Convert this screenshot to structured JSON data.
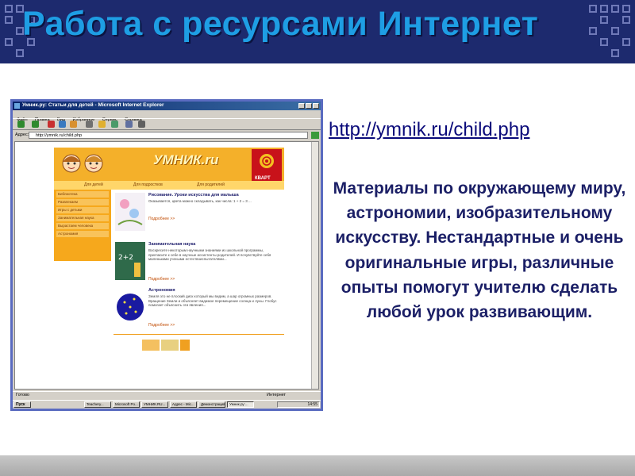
{
  "slide": {
    "title": "Работа с ресурсами Интернет",
    "url": "http://ymnik.ru/child.php",
    "description": "Материалы по окружающему миру, астрономии, изобразительному искусству. Нестандартные и очень оригинальные игры, различные опыты помогут учителю сделать любой урок развивающим.",
    "colors": {
      "header_bg": "#1d2a6e",
      "title": "#1e9ee4",
      "text": "#1b1f66"
    }
  },
  "browser": {
    "title": "Умник.ру: Статьи для детей - Microsoft Internet Explorer",
    "menu": [
      "Файл",
      "Правка",
      "Вид",
      "Избранное",
      "Сервис",
      "Справка"
    ],
    "toolbar_icons": [
      "back-icon",
      "forward-icon",
      "stop-icon",
      "refresh-icon",
      "home-icon",
      "search-icon",
      "favorites-icon",
      "history-icon",
      "mail-icon",
      "print-icon"
    ],
    "address_label": "Адрес:",
    "address": "http://ymnik.ru/child.php",
    "status_left": "Готово",
    "status_right": "Интернет"
  },
  "site": {
    "logo": "УМНИК.ru",
    "brand": "КВАРТ",
    "nav": [
      "Для детей",
      "Для подростков",
      "Для родителей"
    ],
    "sidebar": [
      "Библиотека",
      "Развлекаем",
      "Игры с детьми",
      "Занимательная наука",
      "Вырастаем человека",
      "Астрономия"
    ],
    "articles": [
      {
        "heading": "Рисование. Уроки искусства для малыша",
        "text": "Оказывается, цвета можно складывать, как числа: 1 + 2 = 3 ...",
        "more": "Подробнее >>"
      },
      {
        "heading": "Занимательная наука",
        "text": "Воскресите некоторым научными знаниями из школьной программы, пригласите к себе в научные ассистенты родителей. И почувствуйте себя маленькими учеными естествоиспытателями...",
        "more": "Подробнее >>"
      },
      {
        "heading": "Астрономия",
        "text": "Земля это не плоский диск который мы видим, а шар огромных размеров. Вращение Земли и объясняет видимое перемещение солнца и луны. Глобус помогает объяснить эти явления...",
        "more": "Подробнее >>"
      }
    ]
  },
  "taskbar": {
    "start": "Пуск",
    "tasks": [
      "Teachery...",
      "Microsoft Po...",
      "УМНИК.RU...",
      "Адрес - Mic...",
      "Демонстрация...",
      "Умник.ру:..."
    ],
    "clock": "14:55"
  }
}
